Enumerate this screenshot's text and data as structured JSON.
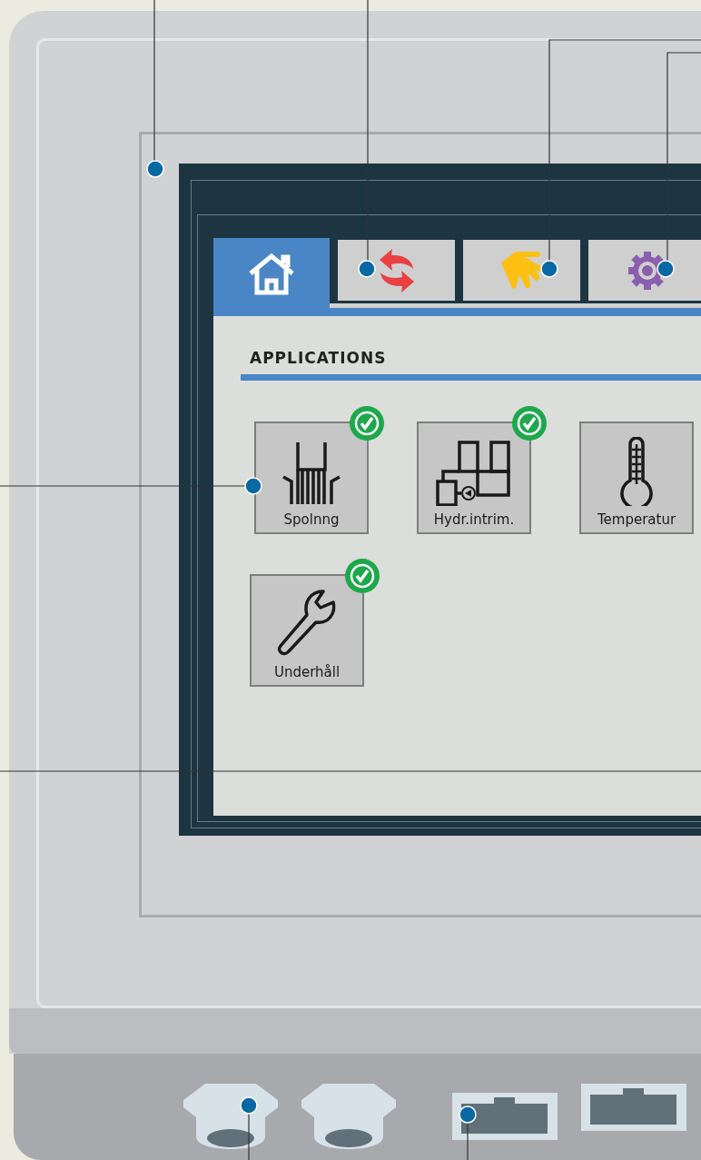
{
  "tabs": [
    {
      "kind": "home",
      "selected": true
    },
    {
      "kind": "sync",
      "selected": false
    },
    {
      "kind": "hand",
      "selected": false
    },
    {
      "kind": "gear",
      "selected": false
    }
  ],
  "section_title": "APPLICATIONS",
  "applications": [
    {
      "label": "Spolnng",
      "kind": "flush",
      "checked": true
    },
    {
      "label": "Hydr.intrim.",
      "kind": "hydraulic",
      "checked": true
    },
    {
      "label": "Temperatur",
      "kind": "thermometer",
      "checked": false
    },
    {
      "label": "Underhåll",
      "kind": "wrench",
      "checked": true
    }
  ]
}
